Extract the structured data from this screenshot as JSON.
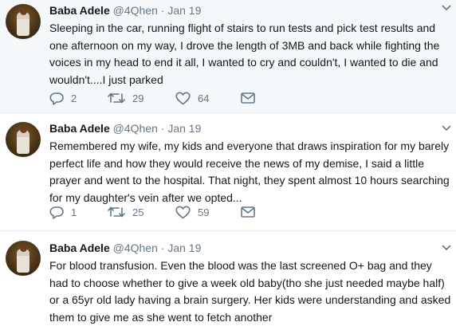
{
  "tweets": [
    {
      "name": "Baba Adele",
      "handle": "@4Qhen",
      "separator": "·",
      "date": "Jan 19",
      "lines": [
        "Sleeping in the car, running flight of stairs to run tests and pick test results and",
        "one afternoon on my way, I drove the length of 3MB and back while fighting the",
        "voices in my head to end it all, I wanted to cry and couldn't, I wanted to die and",
        "wouldn't....I just parked"
      ],
      "replies": "2",
      "retweets": "29",
      "likes": "64"
    },
    {
      "name": "Baba Adele",
      "handle": "@4Qhen",
      "separator": "·",
      "date": "Jan 19",
      "lines": [
        "Remembered my wife, my kids and everyone that draws inspiration for my barely",
        "perfect life and how they would receive the news of my demise, I said a little",
        "prayer and went to the hospital. That night, they spent almost 10 hours searching",
        "for my daughter's vein after we opted..."
      ],
      "replies": "1",
      "retweets": "25",
      "likes": "59"
    },
    {
      "name": "Baba Adele",
      "handle": "@4Qhen",
      "separator": "·",
      "date": "Jan 19",
      "lines": [
        "For blood transfusion. Even the blood was the last screened O+ bag and they",
        "had to choose whether to give a week old baby(tho she just needed maybe half)",
        "or a 65yr old lady having a brain surgery. Her kids were understanding and asked",
        "them to give me as she went to fetch another"
      ]
    }
  ],
  "colors": {
    "text": "#14171a",
    "muted": "#657786",
    "highlight_bg": "#f5f8fa",
    "divider": "#e6ecf0"
  },
  "icons": [
    "reply-icon",
    "retweet-icon",
    "like-icon",
    "direct-message-icon",
    "chevron-down-icon"
  ]
}
